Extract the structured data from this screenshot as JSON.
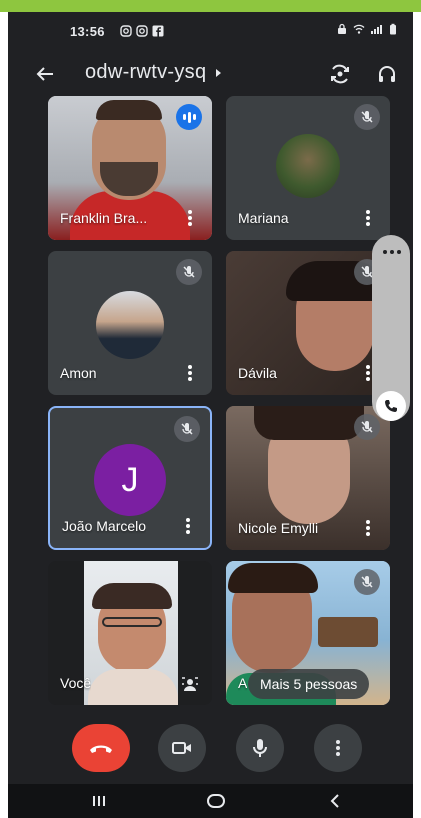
{
  "status_bar": {
    "time": "13:56",
    "notification_icons": [
      "instagram-icon",
      "instagram-icon",
      "facebook-icon"
    ],
    "system_icons": [
      "lock-icon",
      "wifi-icon",
      "signal-icon",
      "battery-icon"
    ]
  },
  "header": {
    "meeting_code": "odw-rwtv-ysq",
    "back_icon": "arrow-back-icon",
    "switch_camera_icon": "switch-camera-icon",
    "audio_output_icon": "headphones-icon"
  },
  "participants": [
    {
      "name": "Franklin Bra...",
      "status": "speaking"
    },
    {
      "name": "Mariana",
      "status": "muted"
    },
    {
      "name": "Amon",
      "status": "muted"
    },
    {
      "name": "Dávila",
      "status": "muted"
    },
    {
      "name": "João Marcelo",
      "status": "muted",
      "avatar_letter": "J",
      "avatar_color": "#7b1fa2",
      "selected": true
    },
    {
      "name": "Nicole Emylli",
      "status": "muted"
    },
    {
      "name": "Você",
      "status": "self"
    },
    {
      "name": "A",
      "status": "muted"
    }
  ],
  "more_people_label": "Mais 5 pessoas",
  "controls": {
    "end_call_icon": "call-end-icon",
    "camera_icon": "videocam-icon",
    "mic_icon": "mic-icon",
    "more_icon": "more-vert-icon"
  },
  "side_panel": {
    "more_icon": "more-horiz-icon",
    "call_icon": "phone-icon"
  },
  "colors": {
    "background": "#202124",
    "tile": "#3c4043",
    "end_call": "#ea4335",
    "speaking": "#1a73e8",
    "selected_border": "#8ab4f8",
    "accent_top": "#8ec63f"
  },
  "android_nav": [
    "recents-icon",
    "home-icon",
    "back-icon"
  ]
}
